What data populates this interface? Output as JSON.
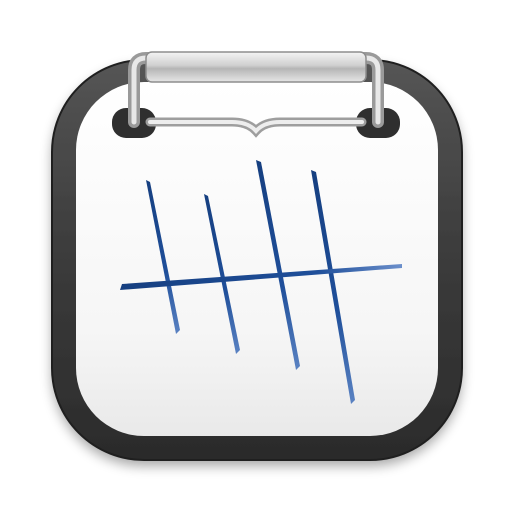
{
  "app_icon": {
    "name": "tally-counter-clipboard",
    "icons": [
      "clipboard-icon",
      "clip-icon",
      "tally-marks-icon"
    ],
    "colors": {
      "frame": "#3c3c3c",
      "frame_dark": "#2a2a2a",
      "paper": "#f7f7f7",
      "paper_shadow": "#e6e6e6",
      "clip_metal": "#c9c9c9",
      "clip_highlight": "#f2f2f2",
      "ink": "#1f4f9a",
      "ink_dark": "#163f80"
    },
    "tally": {
      "vertical_marks": 4,
      "strike_marks": 1,
      "total": 5
    }
  }
}
